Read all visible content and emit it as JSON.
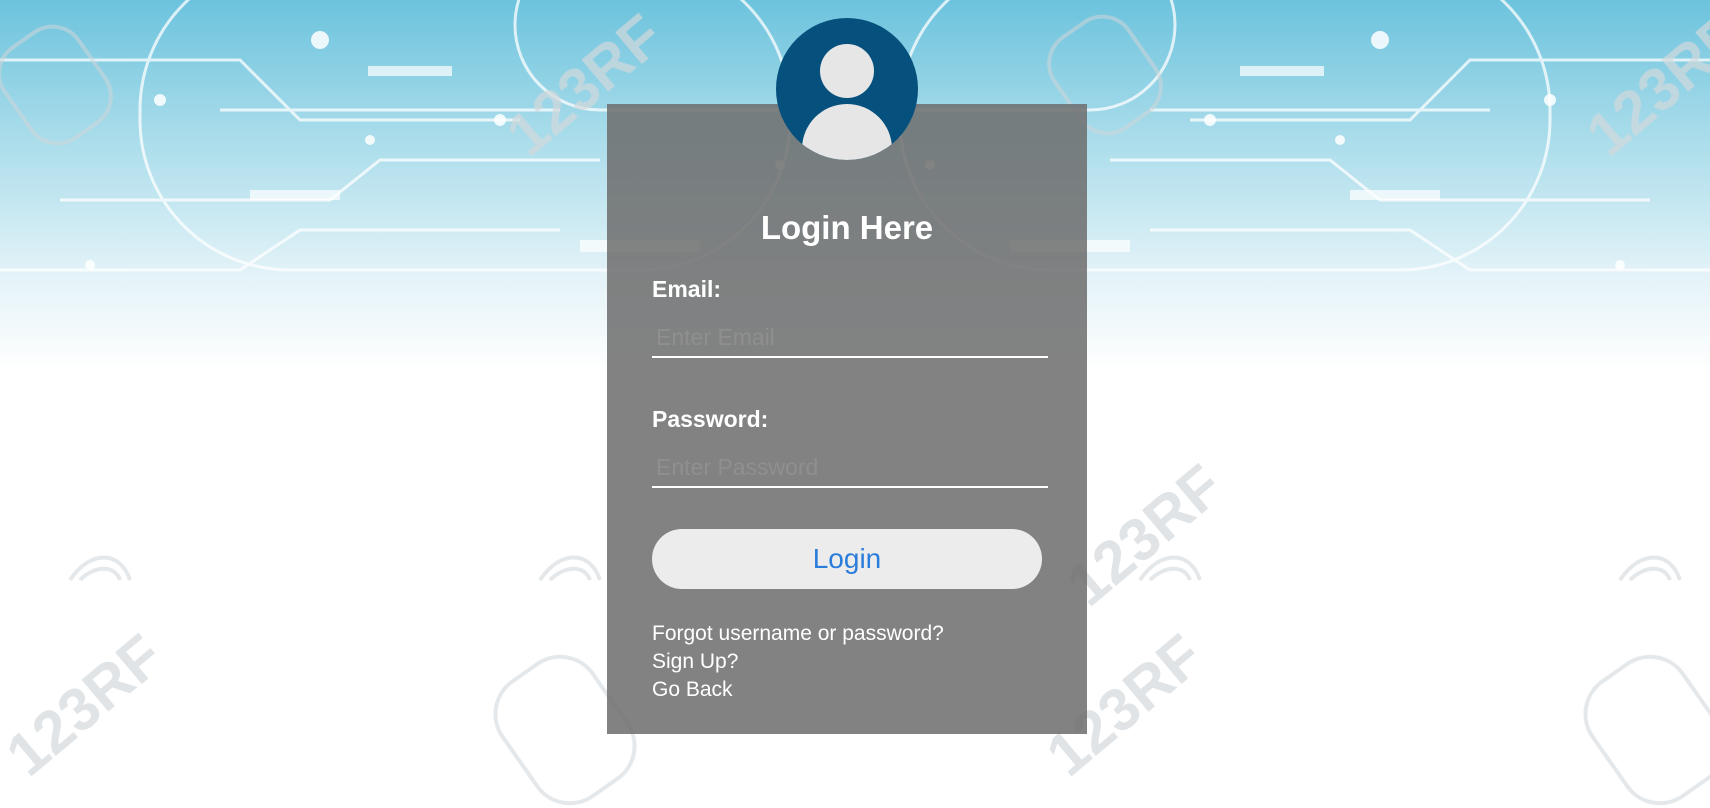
{
  "login_form": {
    "title": "Login Here",
    "email_label": "Email:",
    "email_placeholder": "Enter Email",
    "email_value": "",
    "password_label": "Password:",
    "password_placeholder": "Enter Password",
    "password_value": "",
    "login_button": "Login",
    "links": {
      "forgot": "Forgot username or password?",
      "signup": "Sign Up?",
      "back": "Go Back"
    }
  },
  "icons": {
    "avatar": "user-avatar-icon"
  },
  "colors": {
    "avatar_bg": "#05507c",
    "panel_bg": "#6e6e6e",
    "button_text": "#2b7ddb",
    "background_accent": "#8fd0e6"
  },
  "background": {
    "watermark_text": "123RF"
  }
}
